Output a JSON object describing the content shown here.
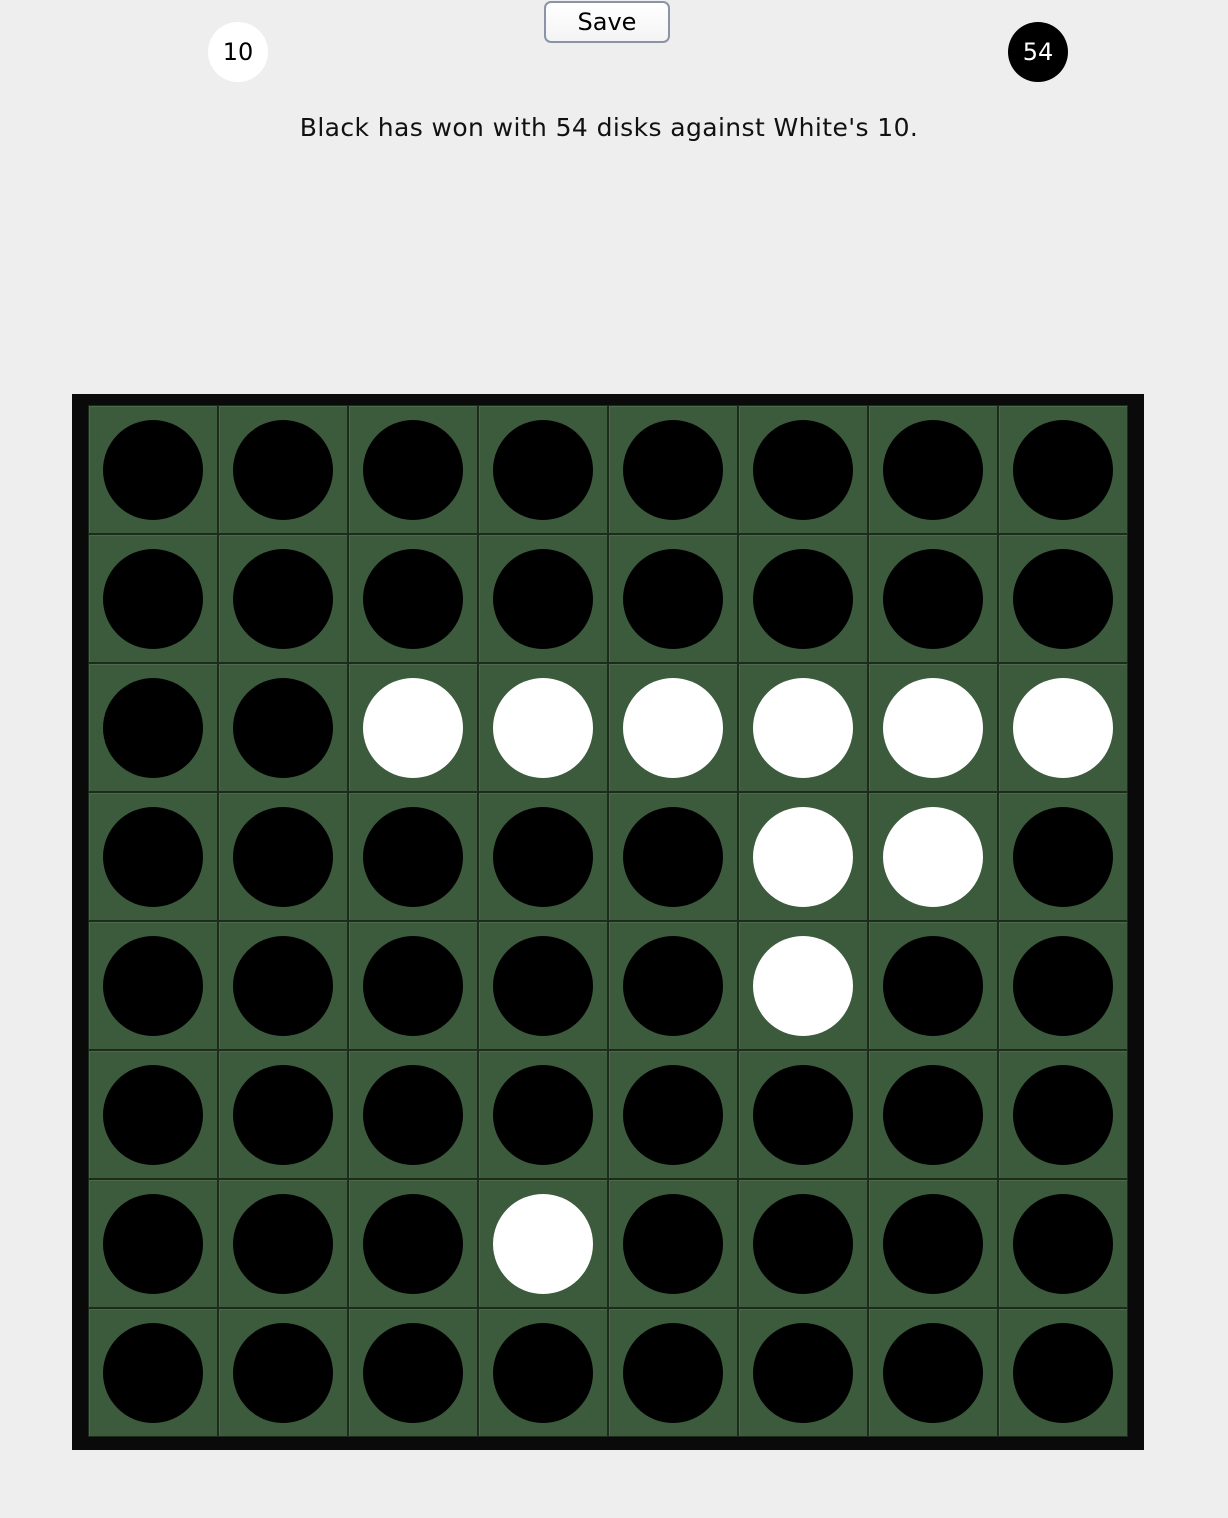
{
  "toolbar": {
    "save_label": "Save"
  },
  "scores": {
    "white": "10",
    "black": "54"
  },
  "status_message": "Black has won with 54 disks against White's 10.",
  "colors": {
    "background": "#eeeeee",
    "board_frame": "#0a0a0a",
    "cell": "#3c5a3c",
    "black_disk": "#000000",
    "white_disk": "#ffffff"
  },
  "board": [
    [
      "black",
      "black",
      "black",
      "black",
      "black",
      "black",
      "black",
      "black"
    ],
    [
      "black",
      "black",
      "black",
      "black",
      "black",
      "black",
      "black",
      "black"
    ],
    [
      "black",
      "black",
      "white",
      "white",
      "white",
      "white",
      "white",
      "white"
    ],
    [
      "black",
      "black",
      "black",
      "black",
      "black",
      "white",
      "white",
      "black"
    ],
    [
      "black",
      "black",
      "black",
      "black",
      "black",
      "white",
      "black",
      "black"
    ],
    [
      "black",
      "black",
      "black",
      "black",
      "black",
      "black",
      "black",
      "black"
    ],
    [
      "black",
      "black",
      "black",
      "white",
      "black",
      "black",
      "black",
      "black"
    ],
    [
      "black",
      "black",
      "black",
      "black",
      "black",
      "black",
      "black",
      "black"
    ]
  ]
}
